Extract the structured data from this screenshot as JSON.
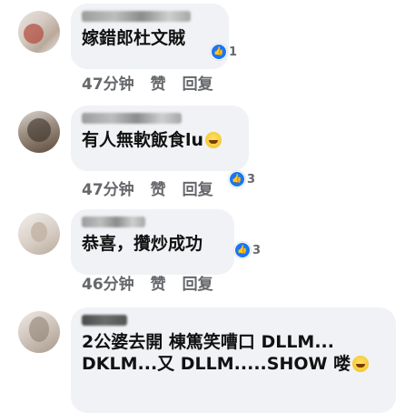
{
  "comments": [
    {
      "text": "嫁錯郎杜文賊",
      "reaction_count": "1",
      "time": "47分钟",
      "like_label": "赞",
      "reply_label": "回复"
    },
    {
      "text": "有人無軟飯食lu",
      "emoji": "laughing-emoji",
      "reaction_count": "3",
      "time": "47分钟",
      "like_label": "赞",
      "reply_label": "回复"
    },
    {
      "text": "恭喜，攢炒成功",
      "reaction_count": "3",
      "time": "46分钟",
      "like_label": "赞",
      "reply_label": "回复"
    },
    {
      "text_line1": "2公婆去開 棟篤笑嘈口 DLLM...",
      "text_line2": "DKLM...又 DLLM.....SHOW 喽",
      "emoji": "laughing-emoji"
    }
  ],
  "colors": {
    "bubble": "#f0f2f5",
    "like_icon": "#1877f2",
    "meta_text": "#65676b"
  }
}
